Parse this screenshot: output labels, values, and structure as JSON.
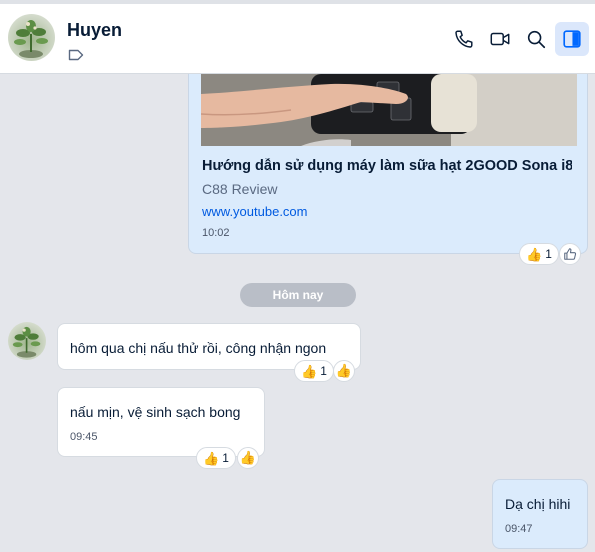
{
  "header": {
    "contact_name": "Huyen",
    "actions": [
      {
        "name": "call",
        "icon": "phone-icon"
      },
      {
        "name": "video",
        "icon": "video-camera-icon"
      },
      {
        "name": "search",
        "icon": "search-icon"
      },
      {
        "name": "panel",
        "icon": "side-panel-icon",
        "active": true
      }
    ]
  },
  "link_message": {
    "title": "Hướng dẫn sử dụng máy làm sữa hạt 2GOOD Sona i8 |...",
    "source": "C88 Review",
    "url": "www.youtube.com",
    "time": "10:02",
    "reaction_count": "1"
  },
  "date_divider": "Hôm nay",
  "messages": [
    {
      "side": "left",
      "text": "hôm qua chị nấu thử rồi, công nhận ngon",
      "time": "",
      "reaction_count": "1"
    },
    {
      "side": "left",
      "text": "nấu mịn, vệ sinh sạch bong",
      "time": "09:45",
      "reaction_count": "1"
    },
    {
      "side": "right",
      "text": "Dạ chị hihi",
      "time": "09:47"
    }
  ],
  "colors": {
    "background": "#e4e6eb",
    "sent_bubble": "#dbebfc",
    "received_bubble": "#ffffff",
    "link": "#005ae0",
    "accent": "#0068ff"
  },
  "emoji": {
    "thumbs_up": "👍"
  }
}
